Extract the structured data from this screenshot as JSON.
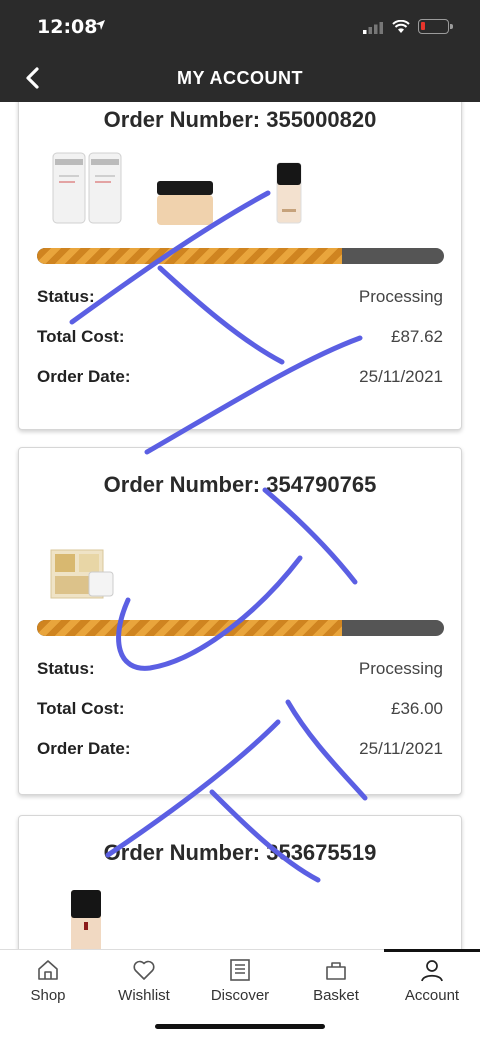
{
  "status_bar": {
    "time": "12:08",
    "icons": [
      "location-arrow-icon",
      "cellular-signal-icon",
      "wifi-icon",
      "battery-icon"
    ],
    "battery_color": "#e8352c"
  },
  "nav": {
    "title": "MY ACCOUNT",
    "back_icon": "chevron-left-icon"
  },
  "labels": {
    "status": "Status:",
    "total_cost": "Total Cost:",
    "order_date": "Order Date:"
  },
  "orders": [
    {
      "order_number": "Order Number: 355000820",
      "progress": 0.75,
      "status": "Processing",
      "total_cost": "£87.62",
      "order_date": "25/11/2021",
      "products": [
        "shampoo-bottle",
        "shampoo-bottle",
        "face-powder-jar",
        "foundation-bottle"
      ]
    },
    {
      "order_number": "Order Number: 354790765",
      "progress": 0.75,
      "status": "Processing",
      "total_cost": "£36.00",
      "order_date": "25/11/2021",
      "products": [
        "gift-set-box"
      ]
    },
    {
      "order_number": "Order Number: 353675519",
      "products": [
        "foundation-bottle"
      ]
    }
  ],
  "progress_colors": {
    "fill": "#e9a53c",
    "stripe": "#cf8420",
    "track": "#555555"
  },
  "scribble_color": "#5b5fe3",
  "tabs": [
    {
      "label": "Shop",
      "icon": "home-icon",
      "active": false
    },
    {
      "label": "Wishlist",
      "icon": "heart-icon",
      "active": false
    },
    {
      "label": "Discover",
      "icon": "document-icon",
      "active": false
    },
    {
      "label": "Basket",
      "icon": "basket-icon",
      "active": false
    },
    {
      "label": "Account",
      "icon": "user-icon",
      "active": true
    }
  ]
}
